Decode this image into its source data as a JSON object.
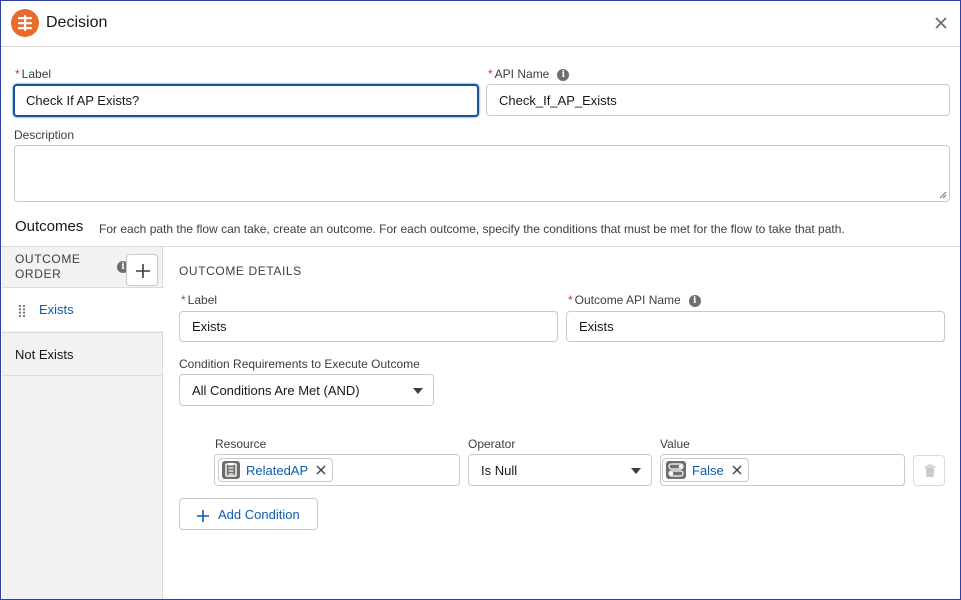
{
  "window": {
    "title": "Decision"
  },
  "fields": {
    "label": {
      "label": "Label",
      "value": "Check If AP Exists?"
    },
    "api_name": {
      "label": "API Name",
      "value": "Check_If_AP_Exists"
    },
    "description": {
      "label": "Description",
      "value": ""
    }
  },
  "outcomes": {
    "heading": "Outcomes",
    "description": "For each path the flow can take, create an outcome. For each outcome, specify the conditions that must be met for the flow to take that path.",
    "order_label_line1": "OUTCOME",
    "order_label_line2": "ORDER",
    "items": [
      {
        "label": "Exists",
        "active": true
      },
      {
        "label": "Not Exists",
        "active": false
      }
    ]
  },
  "details": {
    "heading": "OUTCOME DETAILS",
    "label": {
      "label": "Label",
      "value": "Exists"
    },
    "api_name": {
      "label": "Outcome API Name",
      "value": "Exists"
    },
    "condition_req": {
      "label": "Condition Requirements to Execute Outcome",
      "value": "All Conditions Are Met (AND)"
    },
    "condition": {
      "resource_label": "Resource",
      "resource_value": "RelatedAP",
      "operator_label": "Operator",
      "operator_value": "Is Null",
      "value_label": "Value",
      "value_value": "False"
    },
    "add_condition": "Add Condition"
  },
  "icons": {
    "app": "decision-icon",
    "close": "close-icon",
    "info": "info-icon",
    "add": "plus-icon",
    "drag": "drag-handle-icon",
    "resource": "record-collection-icon",
    "boolean": "toggle-icon",
    "delete": "trash-icon"
  },
  "colors": {
    "accent": "#0b5cab",
    "app_icon": "#e86a2c",
    "required": "#c23934",
    "focus_border": "#1b5297"
  }
}
